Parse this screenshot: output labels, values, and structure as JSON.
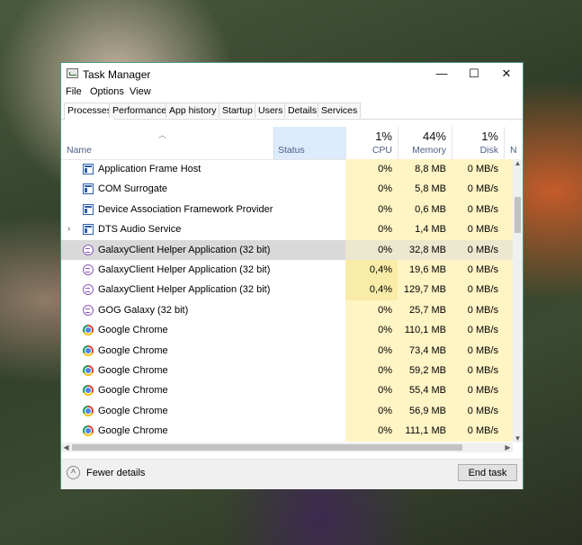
{
  "window": {
    "title": "Task Manager",
    "minimize": "—",
    "maximize": "☐",
    "close": "✕"
  },
  "menu": [
    "File",
    "Options",
    "View"
  ],
  "tabs": [
    "Processes",
    "Performance",
    "App history",
    "Startup",
    "Users",
    "Details",
    "Services"
  ],
  "active_tab": "Processes",
  "columns": {
    "name": "Name",
    "status": "Status",
    "cpu": {
      "label": "CPU",
      "total": "1%"
    },
    "memory": {
      "label": "Memory",
      "total": "44%"
    },
    "disk": {
      "label": "Disk",
      "total": "1%"
    },
    "network": {
      "label": "N"
    }
  },
  "processes": [
    {
      "name": "Application Frame Host",
      "icon": "app-window-icon",
      "cpu": "0%",
      "memory": "8,8 MB",
      "disk": "0 MB/s"
    },
    {
      "name": "COM Surrogate",
      "icon": "app-window-icon",
      "cpu": "0%",
      "memory": "5,8 MB",
      "disk": "0 MB/s"
    },
    {
      "name": "Device Association Framework Provider Host",
      "icon": "app-window-icon",
      "cpu": "0%",
      "memory": "0,6 MB",
      "disk": "0 MB/s"
    },
    {
      "name": "DTS Audio Service",
      "icon": "app-window-icon",
      "cpu": "0%",
      "memory": "1,4 MB",
      "disk": "0 MB/s",
      "expandable": true
    },
    {
      "name": "GalaxyClient Helper Application (32 bit)",
      "icon": "galaxy-icon",
      "cpu": "0%",
      "memory": "32,8 MB",
      "disk": "0 MB/s",
      "selected": true
    },
    {
      "name": "GalaxyClient Helper Application (32 bit)",
      "icon": "galaxy-icon",
      "cpu": "0,4%",
      "memory": "19,6 MB",
      "disk": "0 MB/s"
    },
    {
      "name": "GalaxyClient Helper Application (32 bit)",
      "icon": "galaxy-icon",
      "cpu": "0,4%",
      "memory": "129,7 MB",
      "disk": "0 MB/s"
    },
    {
      "name": "GOG Galaxy (32 bit)",
      "icon": "galaxy-icon",
      "cpu": "0%",
      "memory": "25,7 MB",
      "disk": "0 MB/s"
    },
    {
      "name": "Google Chrome",
      "icon": "chrome-icon",
      "cpu": "0%",
      "memory": "110,1 MB",
      "disk": "0 MB/s"
    },
    {
      "name": "Google Chrome",
      "icon": "chrome-icon",
      "cpu": "0%",
      "memory": "73,4 MB",
      "disk": "0 MB/s"
    },
    {
      "name": "Google Chrome",
      "icon": "chrome-icon",
      "cpu": "0%",
      "memory": "59,2 MB",
      "disk": "0 MB/s"
    },
    {
      "name": "Google Chrome",
      "icon": "chrome-icon",
      "cpu": "0%",
      "memory": "55,4 MB",
      "disk": "0 MB/s"
    },
    {
      "name": "Google Chrome",
      "icon": "chrome-icon",
      "cpu": "0%",
      "memory": "56,9 MB",
      "disk": "0 MB/s"
    },
    {
      "name": "Google Chrome",
      "icon": "chrome-icon",
      "cpu": "0%",
      "memory": "111,1 MB",
      "disk": "0 MB/s"
    }
  ],
  "footer": {
    "fewer_details": "Fewer details",
    "end_task": "End task"
  },
  "colors": {
    "accent_border": "#4a9a86",
    "usage_fill": "#fff4c4",
    "status_header": "#dcecfc",
    "selected_row": "#d9d9d9"
  }
}
